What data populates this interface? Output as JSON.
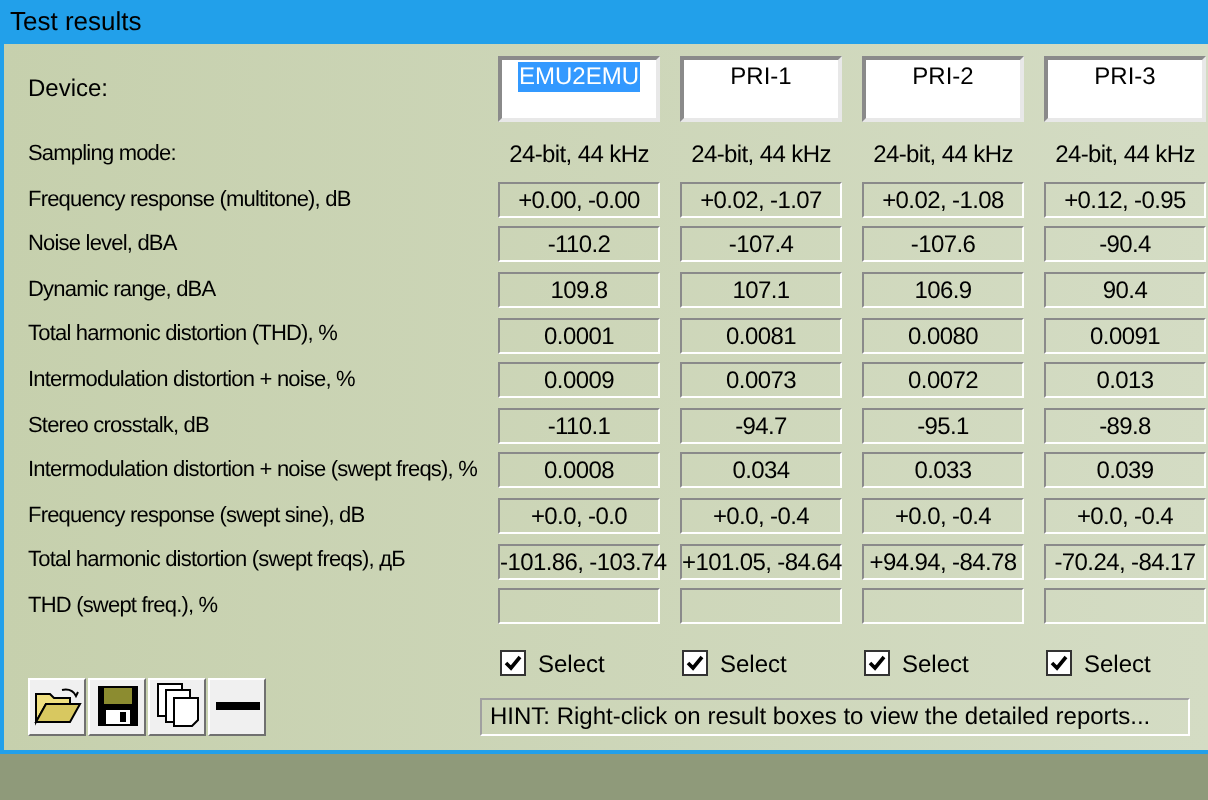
{
  "window": {
    "title": "Test results"
  },
  "device_label": "Device:",
  "devices": [
    {
      "name": "EMU2EMU",
      "selected": true
    },
    {
      "name": "PRI-1",
      "selected": false
    },
    {
      "name": "PRI-2",
      "selected": false
    },
    {
      "name": "PRI-3",
      "selected": false
    }
  ],
  "rows": [
    {
      "label": "Sampling mode:",
      "kind": "text",
      "values": [
        "24-bit, 44 kHz",
        "24-bit, 44 kHz",
        "24-bit, 44 kHz",
        "24-bit, 44 kHz"
      ]
    },
    {
      "label": "Frequency response (multitone), dB",
      "kind": "box",
      "values": [
        "+0.00, -0.00",
        "+0.02, -1.07",
        "+0.02, -1.08",
        "+0.12, -0.95"
      ]
    },
    {
      "label": "Noise level, dBA",
      "kind": "box",
      "values": [
        "-110.2",
        "-107.4",
        "-107.6",
        "-90.4"
      ]
    },
    {
      "label": "Dynamic range, dBA",
      "kind": "box",
      "values": [
        "109.8",
        "107.1",
        "106.9",
        "90.4"
      ]
    },
    {
      "label": "Total harmonic distortion (THD), %",
      "kind": "box",
      "values": [
        "0.0001",
        "0.0081",
        "0.0080",
        "0.0091"
      ]
    },
    {
      "label": "Intermodulation distortion + noise, %",
      "kind": "box",
      "values": [
        "0.0009",
        "0.0073",
        "0.0072",
        "0.013"
      ]
    },
    {
      "label": "Stereo crosstalk, dB",
      "kind": "box",
      "values": [
        "-110.1",
        "-94.7",
        "-95.1",
        "-89.8"
      ]
    },
    {
      "label": "Intermodulation distortion + noise (swept freqs), %",
      "kind": "box",
      "values": [
        "0.0008",
        "0.034",
        "0.033",
        "0.039"
      ]
    },
    {
      "label": "Frequency response (swept sine), dB",
      "kind": "box",
      "values": [
        "+0.0, -0.0",
        "+0.0, -0.4",
        "+0.0, -0.4",
        "+0.0, -0.4"
      ]
    },
    {
      "label": "Total harmonic distortion (swept freqs), дБ",
      "kind": "box",
      "values": [
        "-101.86, -103.74",
        "+101.05, -84.64",
        "+94.94, -84.78",
        "-70.24, -84.17"
      ]
    },
    {
      "label": "THD (swept freq.), %",
      "kind": "blank"
    }
  ],
  "selects": [
    {
      "label": "Select",
      "checked": true
    },
    {
      "label": "Select",
      "checked": true
    },
    {
      "label": "Select",
      "checked": true
    },
    {
      "label": "Select",
      "checked": true
    }
  ],
  "hint": "HINT: Right-click on result boxes to view the detailed reports..."
}
